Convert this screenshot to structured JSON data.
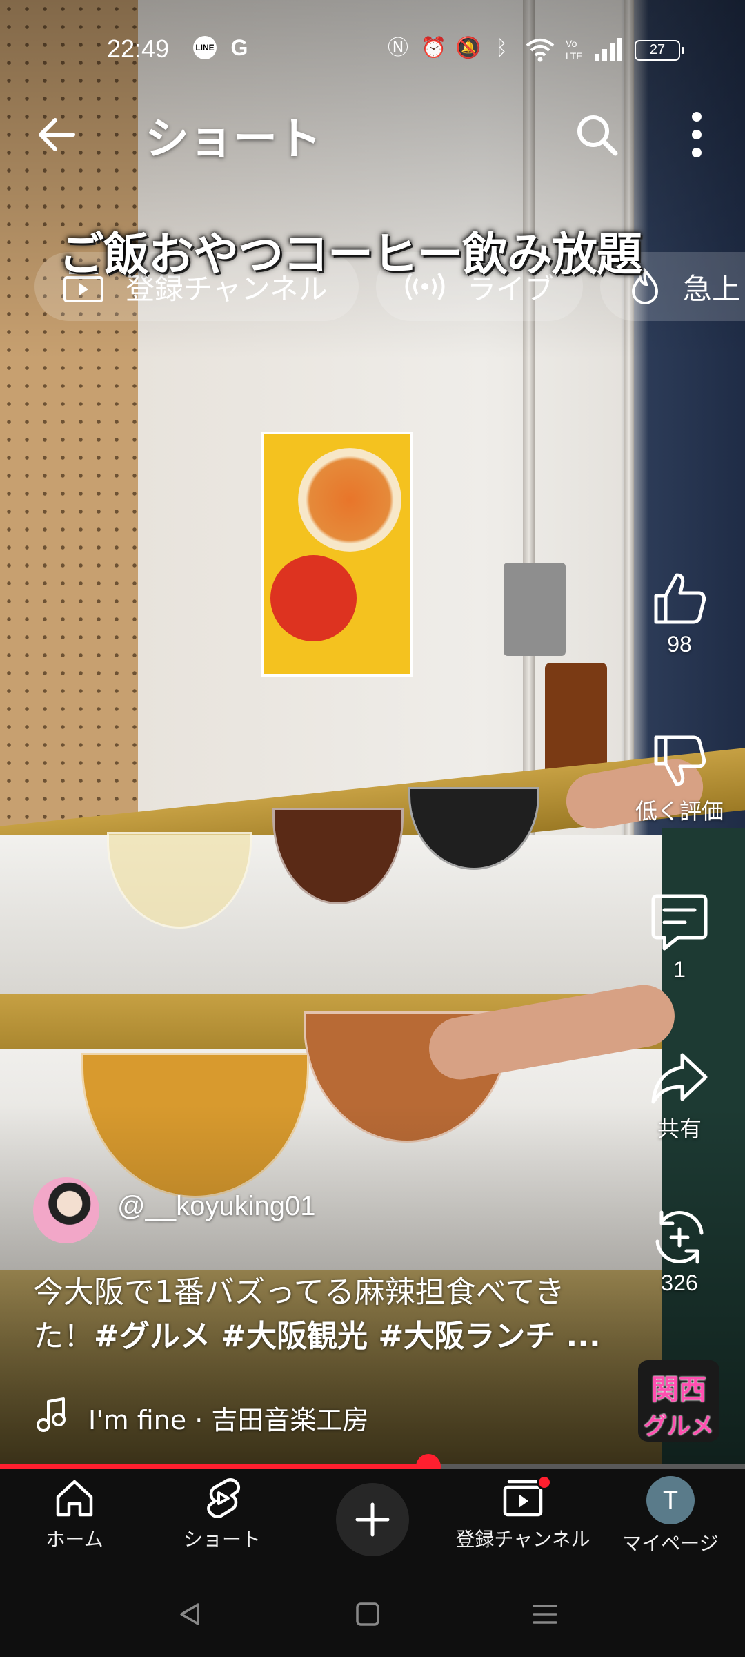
{
  "status_bar": {
    "time": "22:49",
    "notif_line": "LINE",
    "notif_g": "G",
    "battery": "27"
  },
  "header": {
    "title": "ショート"
  },
  "overlay_caption": "ご飯おやつコーヒー飲み放題",
  "chips": [
    {
      "label": "登録チャンネル",
      "icon": "subscriptions-icon"
    },
    {
      "label": "ライブ",
      "icon": "live-icon"
    },
    {
      "label": "急上",
      "icon": "trending-icon"
    }
  ],
  "actions": {
    "like_count": "98",
    "dislike_label": "低く評価",
    "comment_count": "1",
    "share_label": "共有",
    "remix_count": "326"
  },
  "channel_badge": {
    "line1": "関西",
    "line2": "グルメ"
  },
  "channel": {
    "handle": "@__koyuking01"
  },
  "description": {
    "line1": "今大阪で1番バズってる麻辣担食べてき",
    "line2_prefix": "た！",
    "line2_tags": "#グルメ #大阪観光 #大阪ランチ ..."
  },
  "music": {
    "text": "I'm fine · 吉田音楽工房"
  },
  "progress": {
    "played_fraction": 0.575
  },
  "bottom_nav": {
    "home": "ホーム",
    "shorts": "ショート",
    "subscriptions": "登録チャンネル",
    "mypage": "マイページ",
    "avatar_letter": "T"
  },
  "colors": {
    "accent_red": "#ff1f2f",
    "nav_bg": "#0f0f0f"
  }
}
